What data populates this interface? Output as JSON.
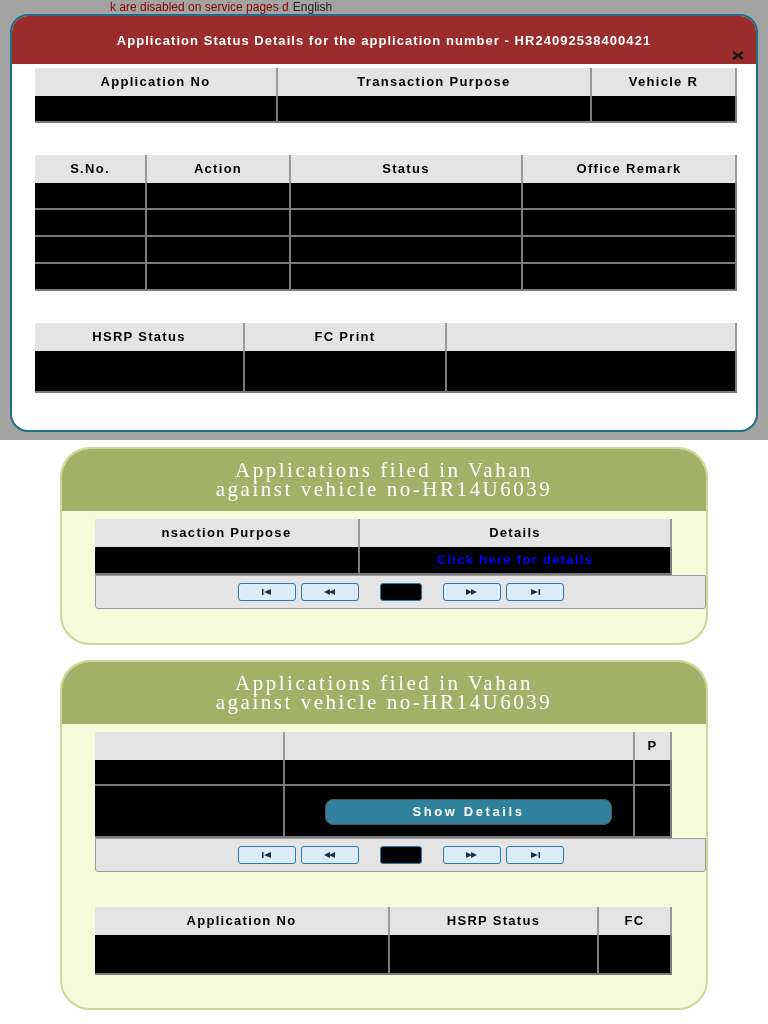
{
  "background": {
    "notice": "k are disabled on service pages d",
    "language": "English"
  },
  "dialog": {
    "title": "Application Status Details for the application number - HR24092538400421",
    "tables": [
      {
        "columns": [
          {
            "label": "Application No"
          },
          {
            "label": "Transaction Purpose"
          },
          {
            "label": "Vehicle R"
          }
        ],
        "rows": [
          {
            "redacted": true
          }
        ]
      },
      {
        "columns": [
          {
            "label": "S.No."
          },
          {
            "label": "Action"
          },
          {
            "label": "Status"
          },
          {
            "label": "Office Remark"
          }
        ],
        "rows": [
          {
            "redacted": true
          },
          {
            "redacted": true
          },
          {
            "redacted": true
          },
          {
            "redacted": true
          }
        ]
      },
      {
        "columns": [
          {
            "label": "HSRP Status"
          },
          {
            "label": "FC Print"
          },
          {}
        ],
        "rows": [
          {
            "redacted": true
          }
        ]
      }
    ]
  },
  "panels": [
    {
      "title": "Applications filed in Vahan against vehicle no-HR14U6039",
      "tables": [
        {
          "columns": [
            {
              "label": "nsaction Purpose"
            },
            {
              "label": "Details"
            }
          ],
          "rows": [
            {
              "redacted": true,
              "link": "Click here for details"
            }
          ],
          "pager": {
            "page_redacted": true
          }
        }
      ]
    },
    {
      "title": "Applications filed in Vahan against vehicle no-HR14U6039",
      "tables": [
        {
          "columns": [
            {},
            {},
            {
              "label": "P"
            }
          ],
          "rows": [
            {
              "redacted": true
            },
            {
              "redacted": true,
              "button": "Show Details"
            }
          ],
          "pager": {
            "page_redacted": true
          }
        },
        {
          "columns": [
            {
              "label": "Application No"
            },
            {
              "label": "HSRP Status"
            },
            {
              "label": "FC"
            }
          ],
          "rows": [
            {
              "redacted": true
            }
          ]
        }
      ]
    }
  ]
}
